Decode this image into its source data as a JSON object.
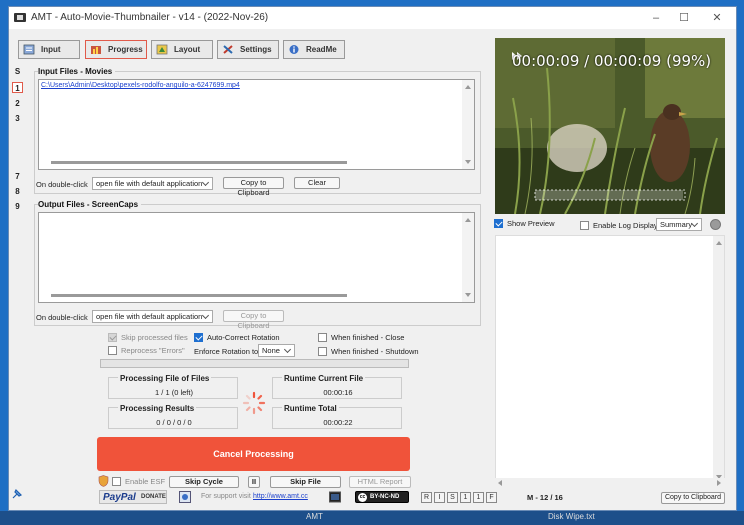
{
  "window": {
    "title": "AMT - Auto-Movie-Thumbnailer - v14 - (2022-Nov-26)",
    "controls": {
      "minimize": "–",
      "maximize": "☐",
      "close": "✕"
    }
  },
  "tabs": [
    {
      "label": "Input",
      "icon": "input-icon"
    },
    {
      "label": "Progress",
      "icon": "progress-icon",
      "active": true
    },
    {
      "label": "Layout",
      "icon": "layout-icon"
    },
    {
      "label": "Settings",
      "icon": "settings-icon"
    },
    {
      "label": "ReadMe",
      "icon": "readme-icon"
    }
  ],
  "side_buttons": [
    "S",
    "1",
    "2",
    "3",
    "7",
    "8",
    "9"
  ],
  "input_group": {
    "title": "Input Files - Movies",
    "file": "C:\\Users\\Admin\\Desktop\\pexels-rodolfo-anguilo-a-6247699.mp4",
    "dblclick_label": "On double-click",
    "dblclick_value": "open file with default application",
    "copy_label": "Copy to Clipboard",
    "clear_label": "Clear"
  },
  "output_group": {
    "title": "Output Files - ScreenCaps",
    "dblclick_label": "On double-click",
    "dblclick_value": "open file with default application",
    "copy_label": "Copy to Clipboard"
  },
  "options": {
    "skip_processed": "Skip processed files",
    "reprocess_errors": "Reprocess \"Errors\"",
    "auto_correct_rotation": "Auto-Correct Rotation",
    "enforce_rotation_label": "Enforce Rotation to",
    "enforce_rotation_value": "None",
    "finished_close": "When finished - Close",
    "finished_shutdown": "When finished - Shutdown"
  },
  "stats": {
    "processing_file_title": "Processing File of Files",
    "processing_file_value": "1 / 1 (0 left)",
    "processing_results_title": "Processing Results",
    "processing_results_value": "0 / 0 / 0 / 0",
    "runtime_current_title": "Runtime Current File",
    "runtime_current_value": "00:00:16",
    "runtime_total_title": "Runtime Total",
    "runtime_total_value": "00:00:22"
  },
  "cancel_label": "Cancel Processing",
  "bottom_row": {
    "enable_esf": "Enable ESF",
    "skip_cycle": "Skip Cycle",
    "pause": "II",
    "skip_file": "Skip File",
    "html_report": "HTML Report"
  },
  "footer": {
    "paypal": "PayPal",
    "donate": "DONATE",
    "support_text": "For support visit",
    "support_link": "http://www.amt.cc",
    "license": "BY-NC-ND",
    "status_buttons": [
      "R",
      "I",
      "S",
      "1",
      "1",
      "F"
    ],
    "counter": "M - 12 / 16",
    "copy_clipboard": "Copy to Clipboard"
  },
  "preview": {
    "time_text": "00:00:09 / 00:00:09 (99%)",
    "show_preview": "Show Preview",
    "enable_log": "Enable Log Display",
    "log_mode": "Summary"
  },
  "taskbar": {
    "left_text": "AMT",
    "right_text": "Disk Wipe.txt"
  }
}
